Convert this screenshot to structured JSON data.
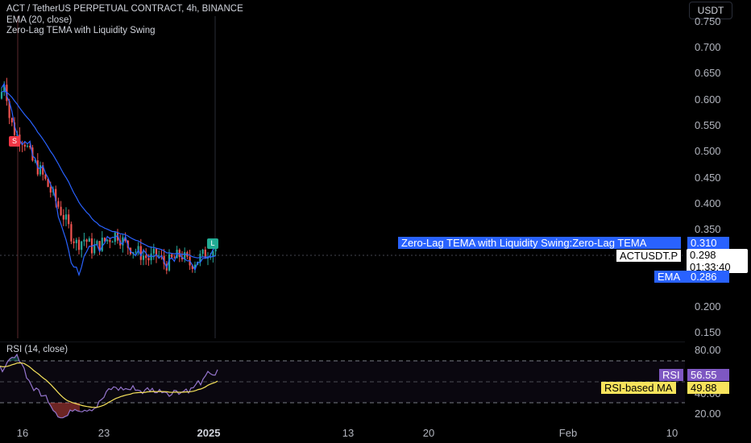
{
  "header": {
    "symbol_title": "ACT / TetherUS PERPETUAL CONTRACT, 4h, BINANCE",
    "indicator_ema": "EMA (20, close)",
    "indicator_zlt": "Zero-Lag TEMA with Liquidity Swing"
  },
  "currency_button": "USDT",
  "price_axis": {
    "ticks": [
      "0.750",
      "0.700",
      "0.650",
      "0.600",
      "0.550",
      "0.500",
      "0.450",
      "0.400",
      "0.350",
      "0.200",
      "0.150"
    ]
  },
  "price_tags": {
    "zlt_label": "Zero-Lag TEMA with Liquidity Swing:Zero-Lag TEMA",
    "zlt_value": "0.310",
    "symbol_label": "ACTUSDT.P",
    "last_price": "0.298",
    "countdown": "01:33:40",
    "ema_label": "EMA",
    "ema_value": "0.286"
  },
  "markers": {
    "sell": "S",
    "long": "L"
  },
  "rsi_panel": {
    "title": "RSI (14, close)",
    "ticks": [
      "80.00",
      "40.00",
      "20.00"
    ],
    "rsi_label": "RSI",
    "rsi_value": "56.55",
    "ma_label": "RSI-based MA",
    "ma_value": "49.88"
  },
  "time_axis": {
    "ticks": [
      "16",
      "23",
      "2025",
      "13",
      "20",
      "Feb",
      "10"
    ]
  },
  "colors": {
    "background": "#000000",
    "up_candle": "#26a69a",
    "down_candle": "#ef5350",
    "ema": "#2962ff",
    "zlt_tag": "#2962ff",
    "rsi_line": "#9575cd",
    "rsi_ma": "#f7e35c",
    "marker_sell": "#f23645",
    "marker_long": "#22ab94"
  }
}
